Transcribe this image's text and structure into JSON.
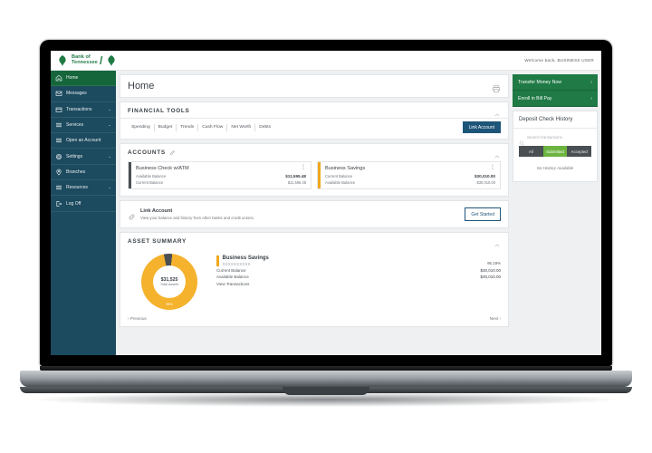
{
  "header": {
    "logo_line1": "Bank of",
    "logo_line2": "Tennessee",
    "welcome": "Welcome back, BUSINESS USER"
  },
  "sidebar": {
    "items": [
      {
        "label": "Home",
        "icon": "home-icon",
        "caret": "",
        "active": true
      },
      {
        "label": "Messages",
        "icon": "envelope-icon",
        "caret": "",
        "active": false
      },
      {
        "label": "Transactions",
        "icon": "card-icon",
        "caret": "⌄",
        "active": false
      },
      {
        "label": "Services",
        "icon": "list-icon",
        "caret": "⌄",
        "active": false
      },
      {
        "label": "Open an Account",
        "icon": "list-icon",
        "caret": "",
        "active": false
      },
      {
        "label": "Settings",
        "icon": "gear-icon",
        "caret": "⌄",
        "active": false
      },
      {
        "label": "Branches",
        "icon": "pin-icon",
        "caret": "",
        "active": false
      },
      {
        "label": "Resources",
        "icon": "list-icon",
        "caret": "⌄",
        "active": false
      },
      {
        "label": "Log Off",
        "icon": "logout-icon",
        "caret": "",
        "active": false
      }
    ]
  },
  "page": {
    "title": "Home"
  },
  "financial_tools": {
    "title": "FINANCIAL TOOLS",
    "tabs": [
      "Spending",
      "Budget",
      "Trends",
      "Cash Flow",
      "Net Worth",
      "Debts"
    ],
    "link_account_button": "Link Account"
  },
  "accounts": {
    "title": "ACCOUNTS",
    "cards": [
      {
        "name": "Business Check w/ATM",
        "stripe_color": "#4a4f54",
        "rows": [
          {
            "label": "Available Balance",
            "value": "$11,595.48"
          },
          {
            "label": "Current Balance",
            "value": "$11,595.48"
          }
        ]
      },
      {
        "name": "Business Savings",
        "stripe_color": "#f0a71d",
        "rows": [
          {
            "label": "Current Balance",
            "value": "$30,010.00"
          },
          {
            "label": "Available Balance",
            "value": "$30,010.00"
          }
        ]
      }
    ]
  },
  "link_account": {
    "title": "Link Account",
    "description": "View your balance and history from other banks and credit unions.",
    "button": "Get Started"
  },
  "asset_summary": {
    "title": "ASSET SUMMARY",
    "account_name": "Business Savings",
    "account_mask": "XXXXXXXXXX",
    "percent": "95.19%",
    "rows": [
      {
        "label": "Current Balance",
        "value": "$30,010.00"
      },
      {
        "label": "Available Balance",
        "value": "$30,010.00"
      }
    ],
    "view_transactions": "View Transactions",
    "previous": "‹ Previous",
    "next": "Next ›"
  },
  "chart_data": {
    "type": "pie",
    "title": "Asset Summary",
    "center_value": "$31,525",
    "center_label": "Total Assets",
    "arc_label": "95%",
    "categories": [
      "Business Savings",
      "Business Check w/ATM"
    ],
    "values": [
      95.19,
      4.81
    ],
    "colors": [
      "#f5b22d",
      "#4a4f54"
    ],
    "legend": "right"
  },
  "rail": {
    "transfer_button": "Transfer Money Now",
    "billpay_button": "Enroll in Bill Pay",
    "chevron": "›",
    "deposit_title": "Deposit Check History",
    "search_placeholder": "Search transactions",
    "filters": [
      {
        "label": "All",
        "active": false
      },
      {
        "label": "Submitted",
        "active": true
      },
      {
        "label": "Accepted",
        "active": false
      }
    ],
    "empty_message": "No History Available"
  },
  "colors": {
    "sidebar": "#1c4a5e",
    "active_nav": "#16663c",
    "brand_green": "#1f7a45",
    "primary_blue": "#1d5579",
    "accent_yellow": "#f0a71d",
    "seg_green": "#6cb43f"
  }
}
